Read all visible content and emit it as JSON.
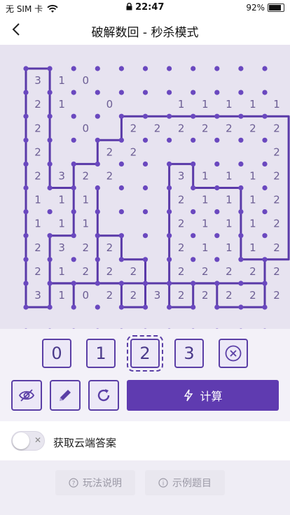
{
  "statusbar": {
    "carrier": "无 SIM 卡",
    "time": "22:47",
    "battery": "92%",
    "battery_level": 0.92
  },
  "navbar": {
    "title": "破解数回 - 秒杀模式"
  },
  "board": {
    "colors": {
      "accent": "#5b3fa6",
      "dot": "#6a48bf",
      "line": "#5a3aa8",
      "text": "#6c5e94"
    },
    "rows": 11,
    "cols": 11,
    "clues": [
      [
        "3",
        "1",
        "0",
        "",
        "",
        "",
        "",
        "",
        "",
        "",
        ""
      ],
      [
        "2",
        "1",
        "",
        "0",
        "",
        "",
        "1",
        "1",
        "1",
        "1",
        "1"
      ],
      [
        "2",
        "",
        "0",
        "",
        "2",
        "2",
        "2",
        "2",
        "2",
        "2",
        "2"
      ],
      [
        "2",
        "",
        "",
        "2",
        "2",
        "",
        "",
        "",
        "",
        "",
        "2"
      ],
      [
        "2",
        "3",
        "2",
        "2",
        "",
        "",
        "3",
        "1",
        "1",
        "1",
        "2"
      ],
      [
        "1",
        "1",
        "1",
        "",
        "",
        "",
        "2",
        "1",
        "1",
        "1",
        "2"
      ],
      [
        "1",
        "1",
        "1",
        "",
        "",
        "",
        "2",
        "1",
        "1",
        "1",
        "2"
      ],
      [
        "2",
        "3",
        "2",
        "2",
        "",
        "",
        "2",
        "1",
        "1",
        "1",
        "2"
      ],
      [
        "2",
        "1",
        "2",
        "2",
        "2",
        "",
        "2",
        "2",
        "2",
        "2",
        "2"
      ],
      [
        "3",
        "1",
        "0",
        "2",
        "2",
        "3",
        "2",
        "2",
        "2",
        "2",
        "2"
      ],
      [
        "",
        "",
        "",
        "",
        "",
        "",
        "",
        "",
        "",
        "",
        ""
      ]
    ],
    "loop_outer": [
      [
        0,
        0
      ],
      [
        1,
        0
      ],
      [
        1,
        5
      ],
      [
        2,
        5
      ],
      [
        2,
        7
      ],
      [
        1,
        7
      ],
      [
        1,
        9
      ],
      [
        4,
        9
      ],
      [
        4,
        10
      ],
      [
        5,
        10
      ],
      [
        5,
        9
      ],
      [
        8,
        9
      ],
      [
        8,
        10
      ],
      [
        10,
        10
      ],
      [
        10,
        8
      ],
      [
        11,
        8
      ],
      [
        11,
        2
      ],
      [
        4,
        2
      ],
      [
        4,
        3
      ],
      [
        3,
        3
      ],
      [
        3,
        4
      ],
      [
        2,
        4
      ],
      [
        2,
        5
      ],
      [
        1,
        5
      ],
      [
        1,
        0
      ]
    ],
    "loop_inner": [
      [
        6,
        4
      ],
      [
        7,
        4
      ],
      [
        7,
        5
      ],
      [
        9,
        5
      ],
      [
        9,
        8
      ],
      [
        10,
        8
      ],
      [
        10,
        9
      ],
      [
        7,
        9
      ],
      [
        7,
        10
      ],
      [
        6,
        10
      ],
      [
        6,
        4
      ]
    ],
    "loop_left": [
      [
        0,
        0
      ],
      [
        0,
        10
      ],
      [
        1,
        10
      ],
      [
        1,
        9
      ],
      [
        2,
        9
      ],
      [
        2,
        10
      ]
    ],
    "loop_mid": [
      [
        3,
        5
      ],
      [
        3,
        9
      ],
      [
        5,
        9
      ],
      [
        5,
        8
      ],
      [
        4,
        8
      ],
      [
        4,
        7
      ],
      [
        3,
        7
      ],
      [
        3,
        5
      ]
    ]
  },
  "keypad": {
    "keys": [
      "0",
      "1",
      "2",
      "3"
    ],
    "selected_index": 2
  },
  "tools": {
    "calc_label": "计算"
  },
  "cloud": {
    "label": "获取云端答案",
    "enabled": false,
    "toggle_x": "✕"
  },
  "footer": {
    "rules_label": "玩法说明",
    "example_label": "示例题目"
  }
}
